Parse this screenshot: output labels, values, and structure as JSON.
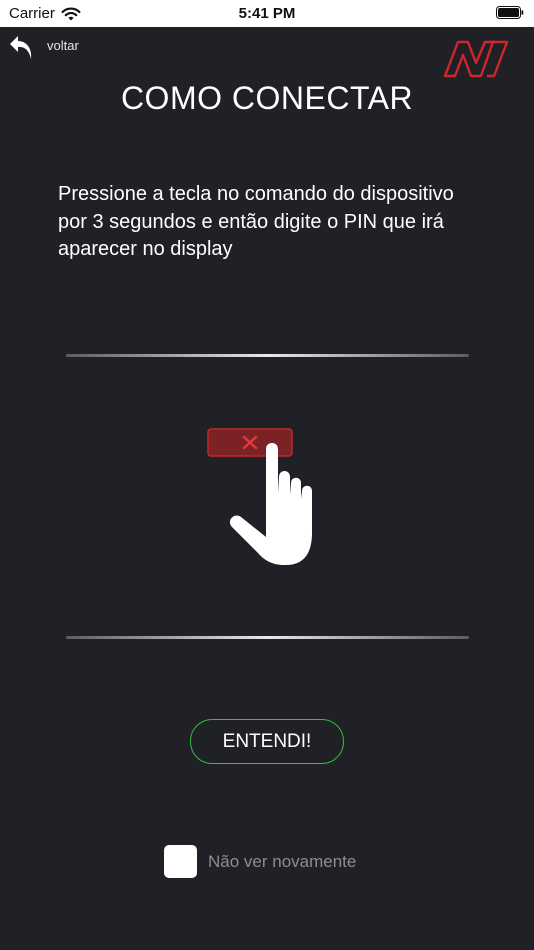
{
  "status_bar": {
    "carrier": "Carrier",
    "time": "5:41 PM",
    "icons": [
      "wifi-icon",
      "battery-icon"
    ]
  },
  "nav": {
    "back_label": "voltar",
    "back_icon": "back-arrow-icon",
    "logo": "brand-logo"
  },
  "page": {
    "title": "COMO CONECTAR",
    "instructions": "Pressione a tecla no comando do dispositivo\n por 3 segundos e então digite o PIN que irá\naparecer no display"
  },
  "illustration": {
    "key_icon": "close-icon",
    "hand_icon": "hand-pointer-icon"
  },
  "actions": {
    "confirm_label": "ENTENDI!",
    "dont_show_label": "Não ver novamente",
    "dont_show_checked": false
  },
  "colors": {
    "background": "#202126",
    "accent_green": "#35c03c",
    "accent_red": "#d0262b",
    "muted_text": "#8c8d92"
  }
}
